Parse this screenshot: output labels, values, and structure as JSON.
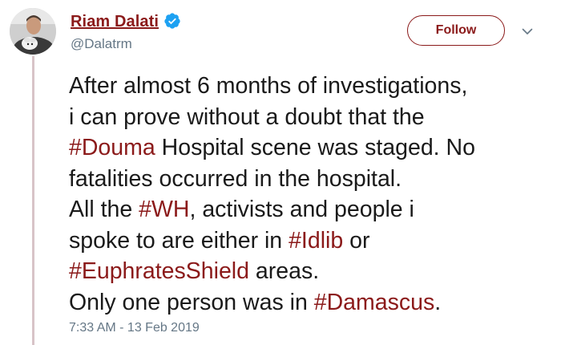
{
  "author": {
    "display_name": "Riam Dalati",
    "handle": "@Dalatrm",
    "verified": true,
    "verified_icon": "verified-badge-icon",
    "avatar_icon": "profile-avatar"
  },
  "actions": {
    "follow_label": "Follow",
    "menu_icon": "chevron-down-icon"
  },
  "tweet": {
    "lines": [
      [
        {
          "text": "After almost 6 months of investigations,"
        }
      ],
      [
        {
          "text": "i can prove without a doubt that the"
        }
      ],
      [
        {
          "hashtag": "#Douma"
        },
        {
          "text": " Hospital scene was staged. No"
        }
      ],
      [
        {
          "text": "fatalities occurred in the hospital."
        }
      ],
      [
        {
          "text": "All the "
        },
        {
          "hashtag": "#WH"
        },
        {
          "text": ", activists and people i"
        }
      ],
      [
        {
          "text": "spoke to are either in "
        },
        {
          "hashtag": "#Idlib"
        },
        {
          "text": " or"
        }
      ],
      [
        {
          "hashtag": "#EuphratesShield"
        },
        {
          "text": " areas."
        }
      ],
      [
        {
          "text": "Only one person was in "
        },
        {
          "hashtag": "#Damascus"
        },
        {
          "text": "."
        }
      ]
    ],
    "timestamp": "7:33 AM - 13 Feb 2019"
  },
  "colors": {
    "link": "#8b1a1a",
    "verified": "#1da1f2",
    "secondary_text": "#657786",
    "thread_line": "#d8c4c8"
  }
}
